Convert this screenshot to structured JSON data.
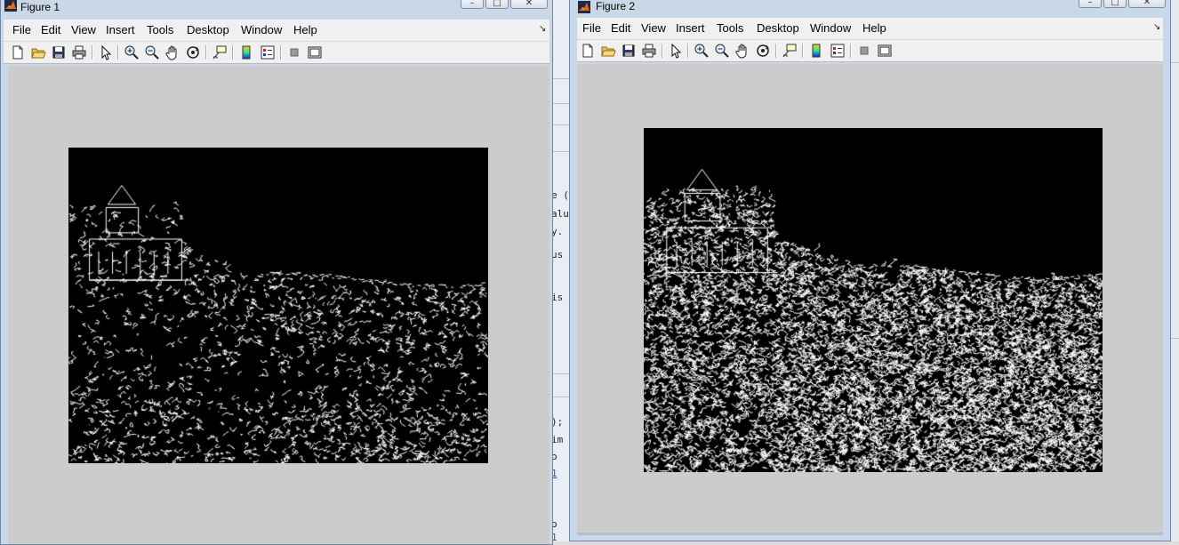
{
  "figure1": {
    "title": "Figure 1",
    "menu": [
      "File",
      "Edit",
      "View",
      "Insert",
      "Tools",
      "Desktop",
      "Window",
      "Help"
    ],
    "window_controls": {
      "minimize": "–",
      "maximize": "□",
      "close": "✕"
    },
    "toolbar_icons": [
      "new-figure-icon",
      "open-file-icon",
      "save-figure-icon",
      "print-figure-icon",
      "edit-plot-icon",
      "zoom-in-icon",
      "zoom-out-icon",
      "pan-icon",
      "rotate-3d-icon",
      "data-cursor-icon",
      "insert-colorbar-icon",
      "insert-legend-icon",
      "hide-plot-tools-icon",
      "show-plot-tools-icon"
    ],
    "image_content": "edge-detection-sparse"
  },
  "figure2": {
    "title": "Figure 2",
    "menu": [
      "File",
      "Edit",
      "View",
      "Insert",
      "Tools",
      "Desktop",
      "Window",
      "Help"
    ],
    "window_controls": {
      "minimize": "–",
      "maximize": "□",
      "close": "✕"
    },
    "toolbar_icons": [
      "new-figure-icon",
      "open-file-icon",
      "save-figure-icon",
      "print-figure-icon",
      "edit-plot-icon",
      "zoom-in-icon",
      "zoom-out-icon",
      "pan-icon",
      "rotate-3d-icon",
      "data-cursor-icon",
      "insert-colorbar-icon",
      "insert-legend-icon",
      "hide-plot-tools-icon",
      "show-plot-tools-icon"
    ],
    "image_content": "edge-detection-dense"
  },
  "background_command_window": {
    "fragments": [
      "e (",
      "alu",
      "y.",
      "us",
      "is",
      ");",
      "im",
      "o",
      "1",
      "o",
      "1"
    ]
  },
  "colors": {
    "title_bar": "#c9d7e7",
    "figure_bg": "#cccccc",
    "menu_bg": "#f0f0f0",
    "edges": "#ffffff",
    "axes_bg": "#000000"
  }
}
